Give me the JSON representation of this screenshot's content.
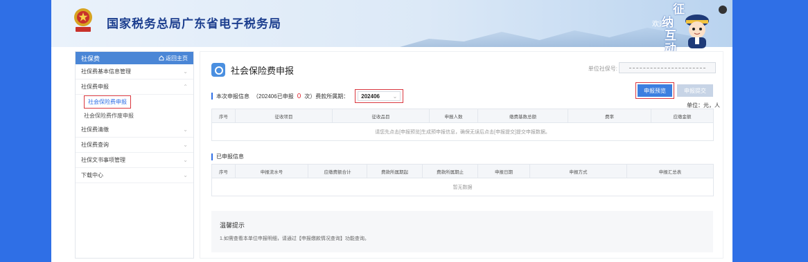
{
  "header": {
    "site_title": "国家税务总局广东省电子税务局",
    "welcome": "欢迎",
    "hudong_chars": [
      "征",
      "纳",
      "互",
      "动"
    ]
  },
  "sidebar": {
    "head_label": "社保费",
    "home_label": "返回主页",
    "items": [
      {
        "label": "社保费基本信息管理"
      },
      {
        "label": "社保费申报"
      },
      {
        "label": "社保费清缴"
      },
      {
        "label": "社保费查询"
      },
      {
        "label": "社保文书事项管理"
      },
      {
        "label": "下载中心"
      }
    ],
    "sub_items": [
      {
        "label": "社会保险费申报"
      },
      {
        "label": "社会保险费作废申报"
      }
    ]
  },
  "main": {
    "page_title": "社会保险费申报",
    "unit_code_label": "单位社保号:",
    "preview_button": "申报预览",
    "submit_button": "申报提交",
    "section1": {
      "title": "本次申报信息",
      "summary_prefix": "（202406已申报",
      "count": "0",
      "summary_suffix": "次）费款所属期：",
      "period_value": "202406"
    },
    "unit_note": "单位：元，人",
    "table1": {
      "headers": [
        "序号",
        "征收项目",
        "征收品目",
        "申报人数",
        "缴费基数总额",
        "费率",
        "应缴金额"
      ],
      "message": "请您先点击[申报预览]生成预申报信息，确保无误后点击[申报提交]提交申报数据。"
    },
    "section2": {
      "title": "已申报信息"
    },
    "table2": {
      "headers": [
        "序号",
        "申报流水号",
        "应缴费额合计",
        "费款所属期起",
        "费款所属期止",
        "申报日期",
        "申报方式",
        "申报汇总表"
      ],
      "message": "暂无数据"
    },
    "tips": {
      "title": "温馨提示",
      "text": "1.如需查看本单位申报明细，请通过【申报缴款情况查询】功能查询。"
    }
  },
  "colors": {
    "page_bg": "#2f6fe6",
    "accent": "#3c7fe0",
    "highlight_border": "#d9363e",
    "title_blue": "#1d3f8f"
  }
}
